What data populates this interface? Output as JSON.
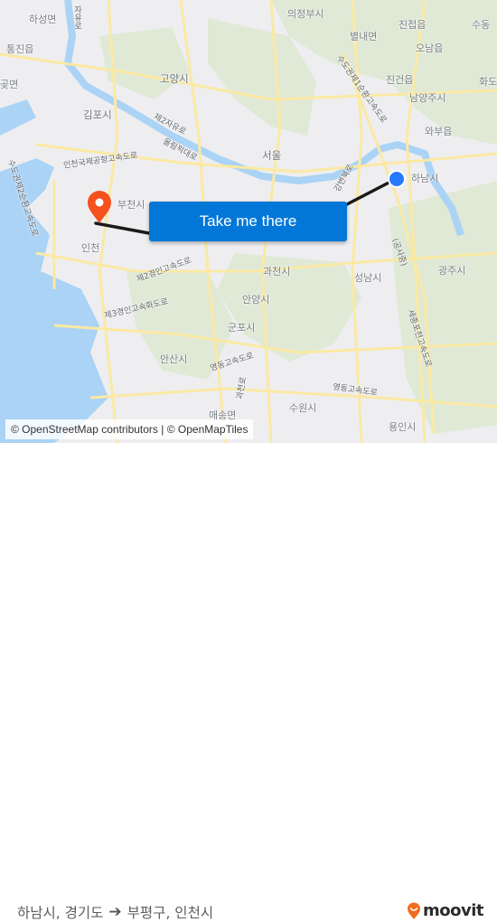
{
  "map": {
    "labels": [
      {
        "id": "hasung",
        "text": "하성면",
        "kind": "town"
      },
      {
        "id": "tongjin",
        "text": "통진읍",
        "kind": "town"
      },
      {
        "id": "got",
        "text": "곶면",
        "kind": "town"
      },
      {
        "id": "gimpo",
        "text": "김포시",
        "kind": "city"
      },
      {
        "id": "goyang",
        "text": "고양시",
        "kind": "city"
      },
      {
        "id": "uijeongbu",
        "text": "의정부시",
        "kind": "city"
      },
      {
        "id": "byeollae",
        "text": "별내면",
        "kind": "town"
      },
      {
        "id": "jinjeop",
        "text": "진접읍",
        "kind": "town"
      },
      {
        "id": "sudong",
        "text": "수동",
        "kind": "town"
      },
      {
        "id": "onam",
        "text": "오남읍",
        "kind": "town"
      },
      {
        "id": "jingeon",
        "text": "진건읍",
        "kind": "town"
      },
      {
        "id": "hwado",
        "text": "화도",
        "kind": "town"
      },
      {
        "id": "namyangju",
        "text": "남양주시",
        "kind": "city"
      },
      {
        "id": "wabu",
        "text": "와부읍",
        "kind": "town"
      },
      {
        "id": "seoul",
        "text": "서울",
        "kind": "city"
      },
      {
        "id": "hanam",
        "text": "하남시",
        "kind": "city"
      },
      {
        "id": "bucheon",
        "text": "부천시",
        "kind": "city"
      },
      {
        "id": "incheon",
        "text": "인천",
        "kind": "city"
      },
      {
        "id": "gwacheon",
        "text": "과천시",
        "kind": "city"
      },
      {
        "id": "seongnam",
        "text": "성남시",
        "kind": "city"
      },
      {
        "id": "gwangju",
        "text": "광주시",
        "kind": "city"
      },
      {
        "id": "anyang",
        "text": "안양시",
        "kind": "city"
      },
      {
        "id": "gunpo",
        "text": "군포시",
        "kind": "city"
      },
      {
        "id": "ansan",
        "text": "안산시",
        "kind": "city"
      },
      {
        "id": "suwon",
        "text": "수원시",
        "kind": "city"
      },
      {
        "id": "yongin",
        "text": "용인시",
        "kind": "city"
      },
      {
        "id": "maesong",
        "text": "매송면",
        "kind": "town"
      }
    ],
    "roads": [
      {
        "id": "jayu",
        "text": "자유로"
      },
      {
        "id": "je2jayu",
        "text": "제2자유로"
      },
      {
        "id": "olympic",
        "text": "올림픽대로"
      },
      {
        "id": "airport",
        "text": "인천국제공항고속도로"
      },
      {
        "id": "sudogwon2",
        "text": "수도권제2순환고속도로"
      },
      {
        "id": "sudogwon1",
        "text": "수도권제1순환고속도로"
      },
      {
        "id": "je2gyeongin",
        "text": "제2경인고속도로"
      },
      {
        "id": "je3gyeongin",
        "text": "제3경인고속화도로"
      },
      {
        "id": "yeongdong1",
        "text": "영동고속도로"
      },
      {
        "id": "yeongdong2",
        "text": "영동고속도로"
      },
      {
        "id": "sejongpocheon",
        "text": "세종포천고속도로"
      },
      {
        "id": "gongsa",
        "text": "(공사중)"
      },
      {
        "id": "gwacheonro",
        "text": "과천로"
      },
      {
        "id": "gangbyeon",
        "text": "강변북로"
      }
    ],
    "origin": {
      "name": "하남시",
      "marker": "blue-dot",
      "color": "#2979ff"
    },
    "destination": {
      "name": "부천시",
      "marker": "pin",
      "color": "#f4511e"
    },
    "route_color": "#1a1a1a",
    "cta": {
      "label": "Take me there",
      "color": "#0277d8"
    },
    "attribution": "© OpenStreetMap contributors | © OpenMapTiles"
  },
  "footer": {
    "origin": "하남시, 경기도",
    "arrow_icon": "arrow-right-icon",
    "destination": "부평구, 인천시",
    "brand": "moovit",
    "brand_color": "#f26c21"
  }
}
